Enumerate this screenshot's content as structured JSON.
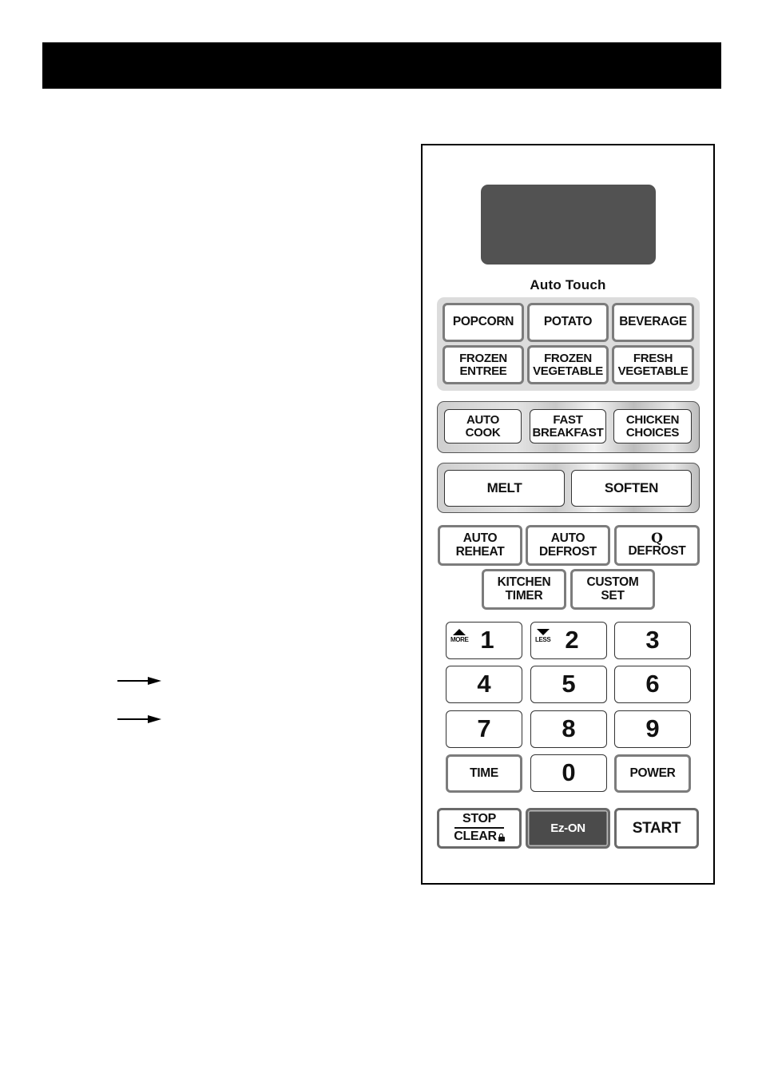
{
  "page": {
    "header_bar": ""
  },
  "panel": {
    "display": "",
    "auto_touch": {
      "title": "Auto Touch",
      "buttons": [
        {
          "line1": "POPCORN",
          "line2": ""
        },
        {
          "line1": "POTATO",
          "line2": ""
        },
        {
          "line1": "BEVERAGE",
          "line2": ""
        },
        {
          "line1": "FROZEN",
          "line2": "ENTREE"
        },
        {
          "line1": "FROZEN",
          "line2": "VEGETABLE"
        },
        {
          "line1": "FRESH",
          "line2": "VEGETABLE"
        }
      ]
    },
    "auto_cook_group": [
      {
        "line1": "AUTO",
        "line2": "COOK"
      },
      {
        "line1": "FAST",
        "line2": "BREAKFAST"
      },
      {
        "line1": "CHICKEN",
        "line2": "CHOICES"
      }
    ],
    "melt_soften_group": [
      {
        "label": "MELT"
      },
      {
        "label": "SOFTEN"
      }
    ],
    "function_buttons": [
      {
        "line1": "AUTO",
        "line2": "REHEAT"
      },
      {
        "line1": "AUTO",
        "line2": "DEFROST"
      },
      {
        "icon": "Q",
        "line2": "DEFROST"
      },
      {
        "line1": "KITCHEN",
        "line2": "TIMER"
      },
      {
        "line1": "CUSTOM",
        "line2": "SET"
      }
    ],
    "keypad": {
      "digits": [
        "1",
        "2",
        "3",
        "4",
        "5",
        "6",
        "7",
        "8",
        "9",
        "0"
      ],
      "more_label": "MORE",
      "less_label": "LESS",
      "time_label": "TIME",
      "power_label": "POWER"
    },
    "bottom_row": {
      "stop_label": "STOP",
      "clear_label": "CLEAR",
      "ez_on_label": "Ez-ON",
      "start_label": "START"
    }
  },
  "colors": {
    "display": "#525252",
    "header_bar": "#000000",
    "ez_on_button": "#4b4b4b",
    "group_background": "#dcdcdc"
  }
}
